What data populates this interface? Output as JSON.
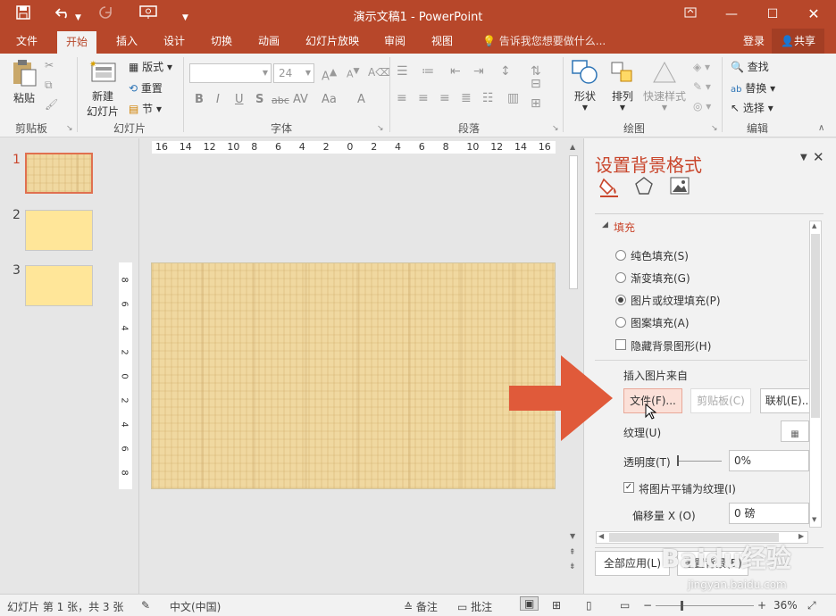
{
  "app": {
    "title": "演示文稿1 - PowerPoint",
    "accent": "#b7472a"
  },
  "titlebar": {
    "save_icon": "save-icon",
    "undo_icon": "undo-icon",
    "redo_icon": "redo-icon",
    "present_icon": "present-from-start-icon"
  },
  "tabs": [
    "文件",
    "开始",
    "插入",
    "设计",
    "切换",
    "动画",
    "幻灯片放映",
    "审阅",
    "视图"
  ],
  "active_tab": "开始",
  "tellme": "告诉我您想要做什么...",
  "signin": "登录",
  "share": "共享",
  "ribbon": {
    "clipboard": {
      "paste": "粘贴",
      "label": "剪贴板"
    },
    "slides": {
      "new_slide_line1": "新建",
      "new_slide_line2": "幻灯片",
      "layout": "版式",
      "reset": "重置",
      "section": "节",
      "label": "幻灯片"
    },
    "font": {
      "size": "24",
      "bold": "B",
      "italic": "I",
      "underline": "U",
      "shadow": "S",
      "strike": "abc",
      "spacing": "AV",
      "grow": "A",
      "case": "Aa",
      "label": "字体"
    },
    "paragraph": {
      "label": "段落"
    },
    "drawing": {
      "shapes": "形状",
      "arrange": "排列",
      "quick_styles": "快速样式",
      "label": "绘图"
    },
    "editing": {
      "find": "查找",
      "replace": "替换",
      "select": "选择",
      "label": "编辑"
    }
  },
  "thumbnails": [
    {
      "num": "1"
    },
    {
      "num": "2"
    },
    {
      "num": "3"
    }
  ],
  "ruler_h": [
    "16",
    "14",
    "12",
    "10",
    "8",
    "6",
    "4",
    "2",
    "0",
    "2",
    "4",
    "6",
    "8",
    "10",
    "12",
    "14",
    "16"
  ],
  "ruler_v": [
    "8",
    "6",
    "4",
    "2",
    "0",
    "2",
    "4",
    "6",
    "8"
  ],
  "pane": {
    "title": "设置背景格式",
    "section": "填充",
    "options": [
      {
        "label": "纯色填充(S)",
        "selected": false
      },
      {
        "label": "渐变填充(G)",
        "selected": false
      },
      {
        "label": "图片或纹理填充(P)",
        "selected": true
      },
      {
        "label": "图案填充(A)",
        "selected": false
      }
    ],
    "hide_bg": "隐藏背景图形(H)",
    "insert_from": "插入图片来自",
    "file_btn": "文件(F)...",
    "clipboard_btn": "剪贴板(C)",
    "online_btn": "联机(E)...",
    "texture": "纹理(U)",
    "transparency_label": "透明度(T)",
    "transparency_value": "0%",
    "tile": "将图片平铺为纹理(I)",
    "offset_label": "偏移量 X (O)",
    "offset_value": "0 磅",
    "apply_all": "全部应用(L)",
    "reset_bg": "重置背景(B)"
  },
  "status": {
    "slide_info": "幻灯片 第 1 张，共 3 张",
    "language": "中文(中国)",
    "notes": "备注",
    "comments": "批注",
    "zoom": "36%"
  },
  "watermark": {
    "line1": "Baidu经验",
    "line2": "jingyan.baidu.com"
  },
  "arrow_color": "#e05a3a"
}
